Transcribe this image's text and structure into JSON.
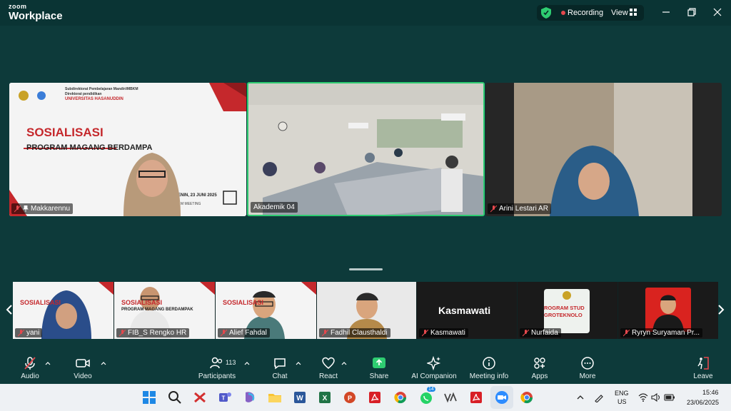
{
  "titlebar": {
    "brand_small": "zoom",
    "brand_big": "Workplace",
    "recording": "Recording",
    "view": "View"
  },
  "stage": {
    "tile1": {
      "header_line1": "Subdirektorat Pembelajaran Mandiri/MBKM",
      "header_line2": "Direktorat pendidikan",
      "header_line3": "UNIVERSITAS HASANUDDIN",
      "title": "SOSIALISASI",
      "subtitle": "PROGRAM MAGANG BERDAMPA",
      "date": "SENIN, 23 JUNI 2025",
      "meeting": "M MEETING",
      "name": "Makkarennu"
    },
    "tile2": {
      "name": "Akademik 04"
    },
    "tile3": {
      "name": "Arini Lestari AR"
    }
  },
  "filmstrip": [
    {
      "name": "yani"
    },
    {
      "name": "FIB_S Rengko HR"
    },
    {
      "name": "Alief Fahdal"
    },
    {
      "name": "Fadhil Clausthaldi"
    },
    {
      "name": "Kasmawati",
      "big_name": "Kasmawati"
    },
    {
      "name": "Nurfaida",
      "logo_text1": "ROGRAM STUD",
      "logo_text2": "GROTEKNOLO"
    },
    {
      "name": "Ryryn Suryaman Pr..."
    }
  ],
  "mini_slide": {
    "title": "SOSIALISASI",
    "subtitle": "PROGRAM MAGANG BERDAMPAK"
  },
  "toolbar": {
    "audio": "Audio",
    "video": "Video",
    "participants": "Participants",
    "participants_count": "113",
    "chat": "Chat",
    "react": "React",
    "share": "Share",
    "ai": "AI Companion",
    "meeting_info": "Meeting info",
    "apps": "Apps",
    "more": "More",
    "leave": "Leave"
  },
  "taskbar": {
    "whatsapp_badge": "14",
    "lang1": "ENG",
    "lang2": "US",
    "time": "15:46",
    "date": "23/06/2025"
  },
  "colors": {
    "accent_green": "#2ecc71",
    "record_red": "#e5484d",
    "slide_red": "#c5282c",
    "bg": "#0d3a3a"
  }
}
